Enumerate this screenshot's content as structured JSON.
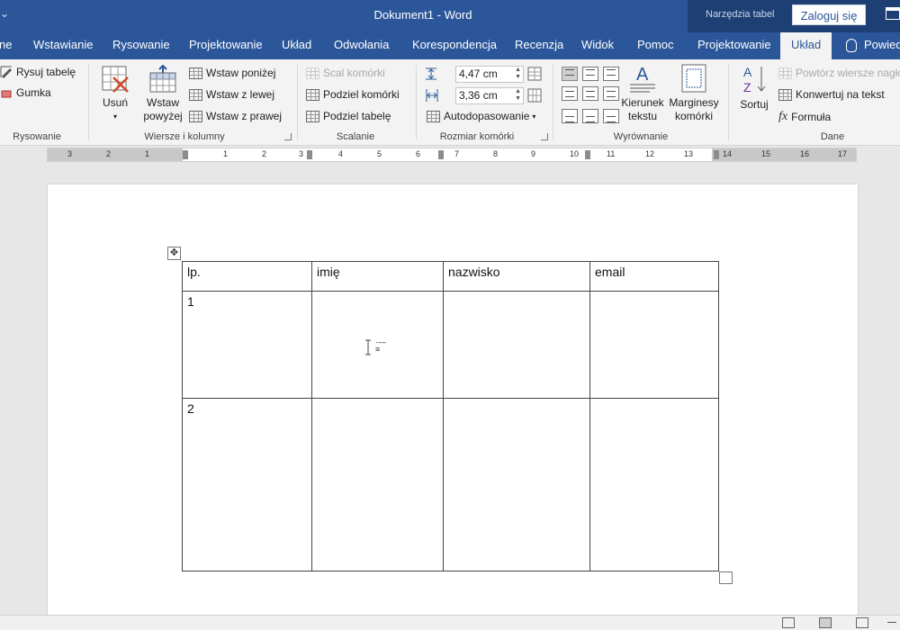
{
  "titlebar": {
    "quick_access": "⌄",
    "document": "Dokument1",
    "separator": "-",
    "app": "Word",
    "context_group": "Narzędzia tabel",
    "login": "Zaloguj się"
  },
  "tabs": [
    {
      "label": "ne"
    },
    {
      "label": "Wstawianie"
    },
    {
      "label": "Rysowanie"
    },
    {
      "label": "Projektowanie"
    },
    {
      "label": "Układ"
    },
    {
      "label": "Odwołania"
    },
    {
      "label": "Korespondencja"
    },
    {
      "label": "Recenzja"
    },
    {
      "label": "Widok"
    },
    {
      "label": "Pomoc"
    },
    {
      "label": "Projektowanie"
    },
    {
      "label": "Układ"
    },
    {
      "label": "Powied"
    }
  ],
  "ribbon": {
    "drawing": {
      "draw_table": "Rysuj tabelę",
      "eraser": "Gumka",
      "label": "Rysowanie"
    },
    "rows_cols": {
      "delete": "Usuń",
      "delete_arrow": "▾",
      "insert_above_1": "Wstaw",
      "insert_above_2": "powyżej",
      "insert_below": "Wstaw poniżej",
      "insert_left": "Wstaw z lewej",
      "insert_right": "Wstaw z prawej",
      "label": "Wiersze i kolumny"
    },
    "merge": {
      "merge_cells": "Scal komórki",
      "split_cells": "Podziel komórki",
      "split_table": "Podziel tabelę",
      "label": "Scalanie"
    },
    "cell_size": {
      "height": "4,47  cm",
      "width": "3,36  cm",
      "autofit": "Autodopasowanie",
      "autofit_arrow": "▾",
      "label": "Rozmiar komórki"
    },
    "alignment": {
      "text_direction_1": "Kierunek",
      "text_direction_2": "tekstu",
      "cell_margins_1": "Marginesy",
      "cell_margins_2": "komórki",
      "label": "Wyrównanie"
    },
    "data": {
      "sort": "Sortuj",
      "repeat_header": "Powtórz wiersze nagłó",
      "convert": "Konwertuj na tekst",
      "formula": "Formuła",
      "label": "Dane"
    }
  },
  "ruler": {
    "numbers": [
      "3",
      "2",
      "1",
      "1",
      "2",
      "3",
      "4",
      "5",
      "6",
      "7",
      "8",
      "9",
      "10",
      "11",
      "12",
      "13",
      "14",
      "15",
      "16",
      "17"
    ]
  },
  "table": {
    "rows": [
      [
        "lp.",
        "imię",
        "nazwisko",
        "email"
      ],
      [
        "1",
        "",
        "",
        ""
      ],
      [
        "2",
        "",
        "",
        ""
      ]
    ]
  },
  "colors": {
    "accent": "#2b579a",
    "context_band": "#1e3f73",
    "ribbon": "#f3f3f3"
  },
  "icons": {
    "eraser": "eraser-icon",
    "move": "table-move-icon",
    "sort": "sort-az-icon",
    "formula": "fx-icon"
  }
}
